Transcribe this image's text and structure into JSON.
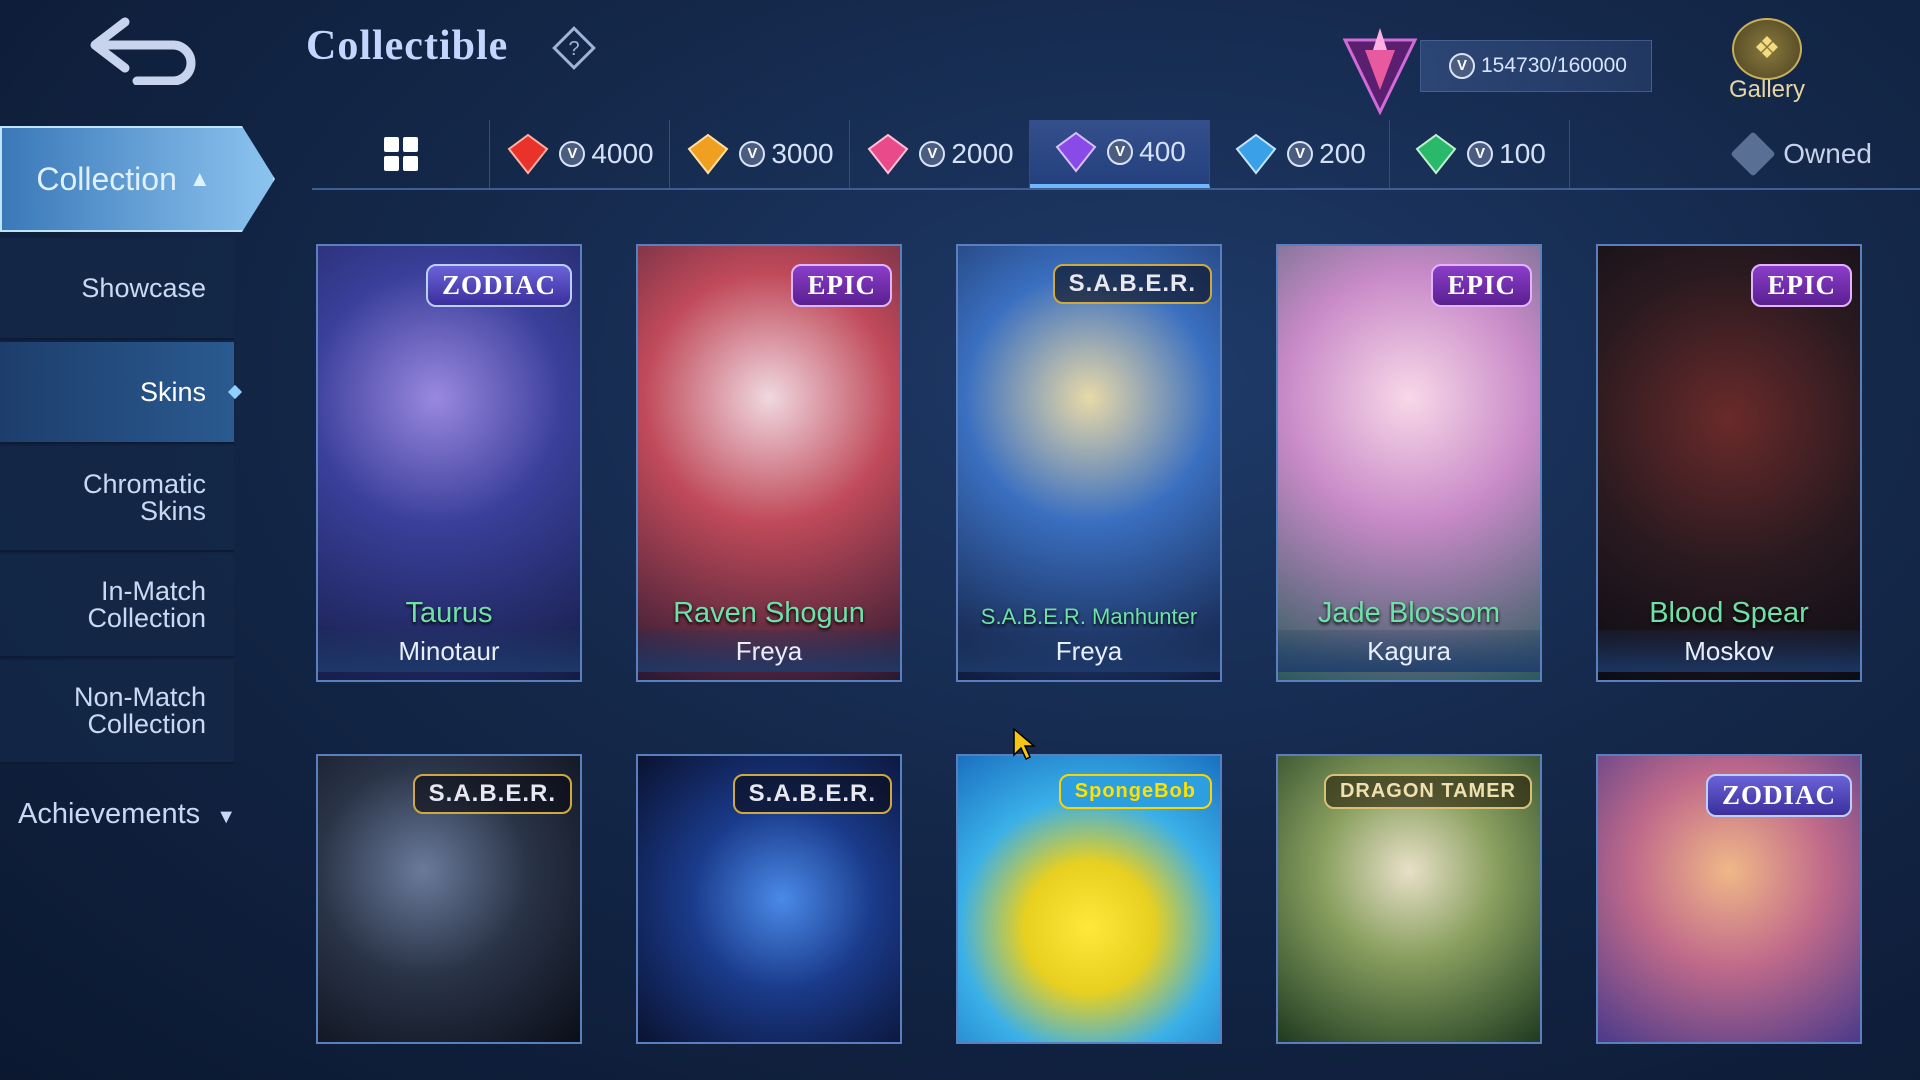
{
  "header": {
    "title": "Collectible",
    "points": "154730/160000",
    "gallery_label": "Gallery"
  },
  "sidebar": {
    "collection_label": "Collection",
    "items": [
      {
        "label": "Showcase"
      },
      {
        "label": "Skins"
      },
      {
        "label_line1": "Chromatic",
        "label_line2": "Skins"
      },
      {
        "label_line1": "In-Match",
        "label_line2": "Collection"
      },
      {
        "label_line1": "Non-Match",
        "label_line2": "Collection"
      }
    ],
    "achievements_label": "Achievements"
  },
  "tabs": [
    {
      "value": "4000",
      "gem_color": "#e8322a"
    },
    {
      "value": "3000",
      "gem_color": "#f0a020"
    },
    {
      "value": "2000",
      "gem_color": "#e84a8a"
    },
    {
      "value": "400",
      "gem_color": "#8a4ae8"
    },
    {
      "value": "200",
      "gem_color": "#3aa0e8"
    },
    {
      "value": "100",
      "gem_color": "#2ab86a"
    }
  ],
  "owned_label": "Owned",
  "cards": [
    {
      "badge": "ZODIAC",
      "skin": "Taurus",
      "hero": "Minotaur"
    },
    {
      "badge": "EPIC",
      "skin": "Raven Shogun",
      "hero": "Freya"
    },
    {
      "badge": "S.A.B.E.R.",
      "skin": "S.A.B.E.R. Manhunter",
      "hero": "Freya"
    },
    {
      "badge": "EPIC",
      "skin": "Jade Blossom",
      "hero": "Kagura"
    },
    {
      "badge": "EPIC",
      "skin": "Blood Spear",
      "hero": "Moskov"
    },
    {
      "badge": "S.A.B.E.R."
    },
    {
      "badge": "S.A.B.E.R."
    },
    {
      "badge": "SpongeBob"
    },
    {
      "badge": "DRAGON TAMER"
    },
    {
      "badge": "ZODIAC"
    }
  ],
  "colors": {
    "accent": "#6fb8ff",
    "skin_name": "#6fe0a8",
    "card_border": "#5a7fbf"
  }
}
